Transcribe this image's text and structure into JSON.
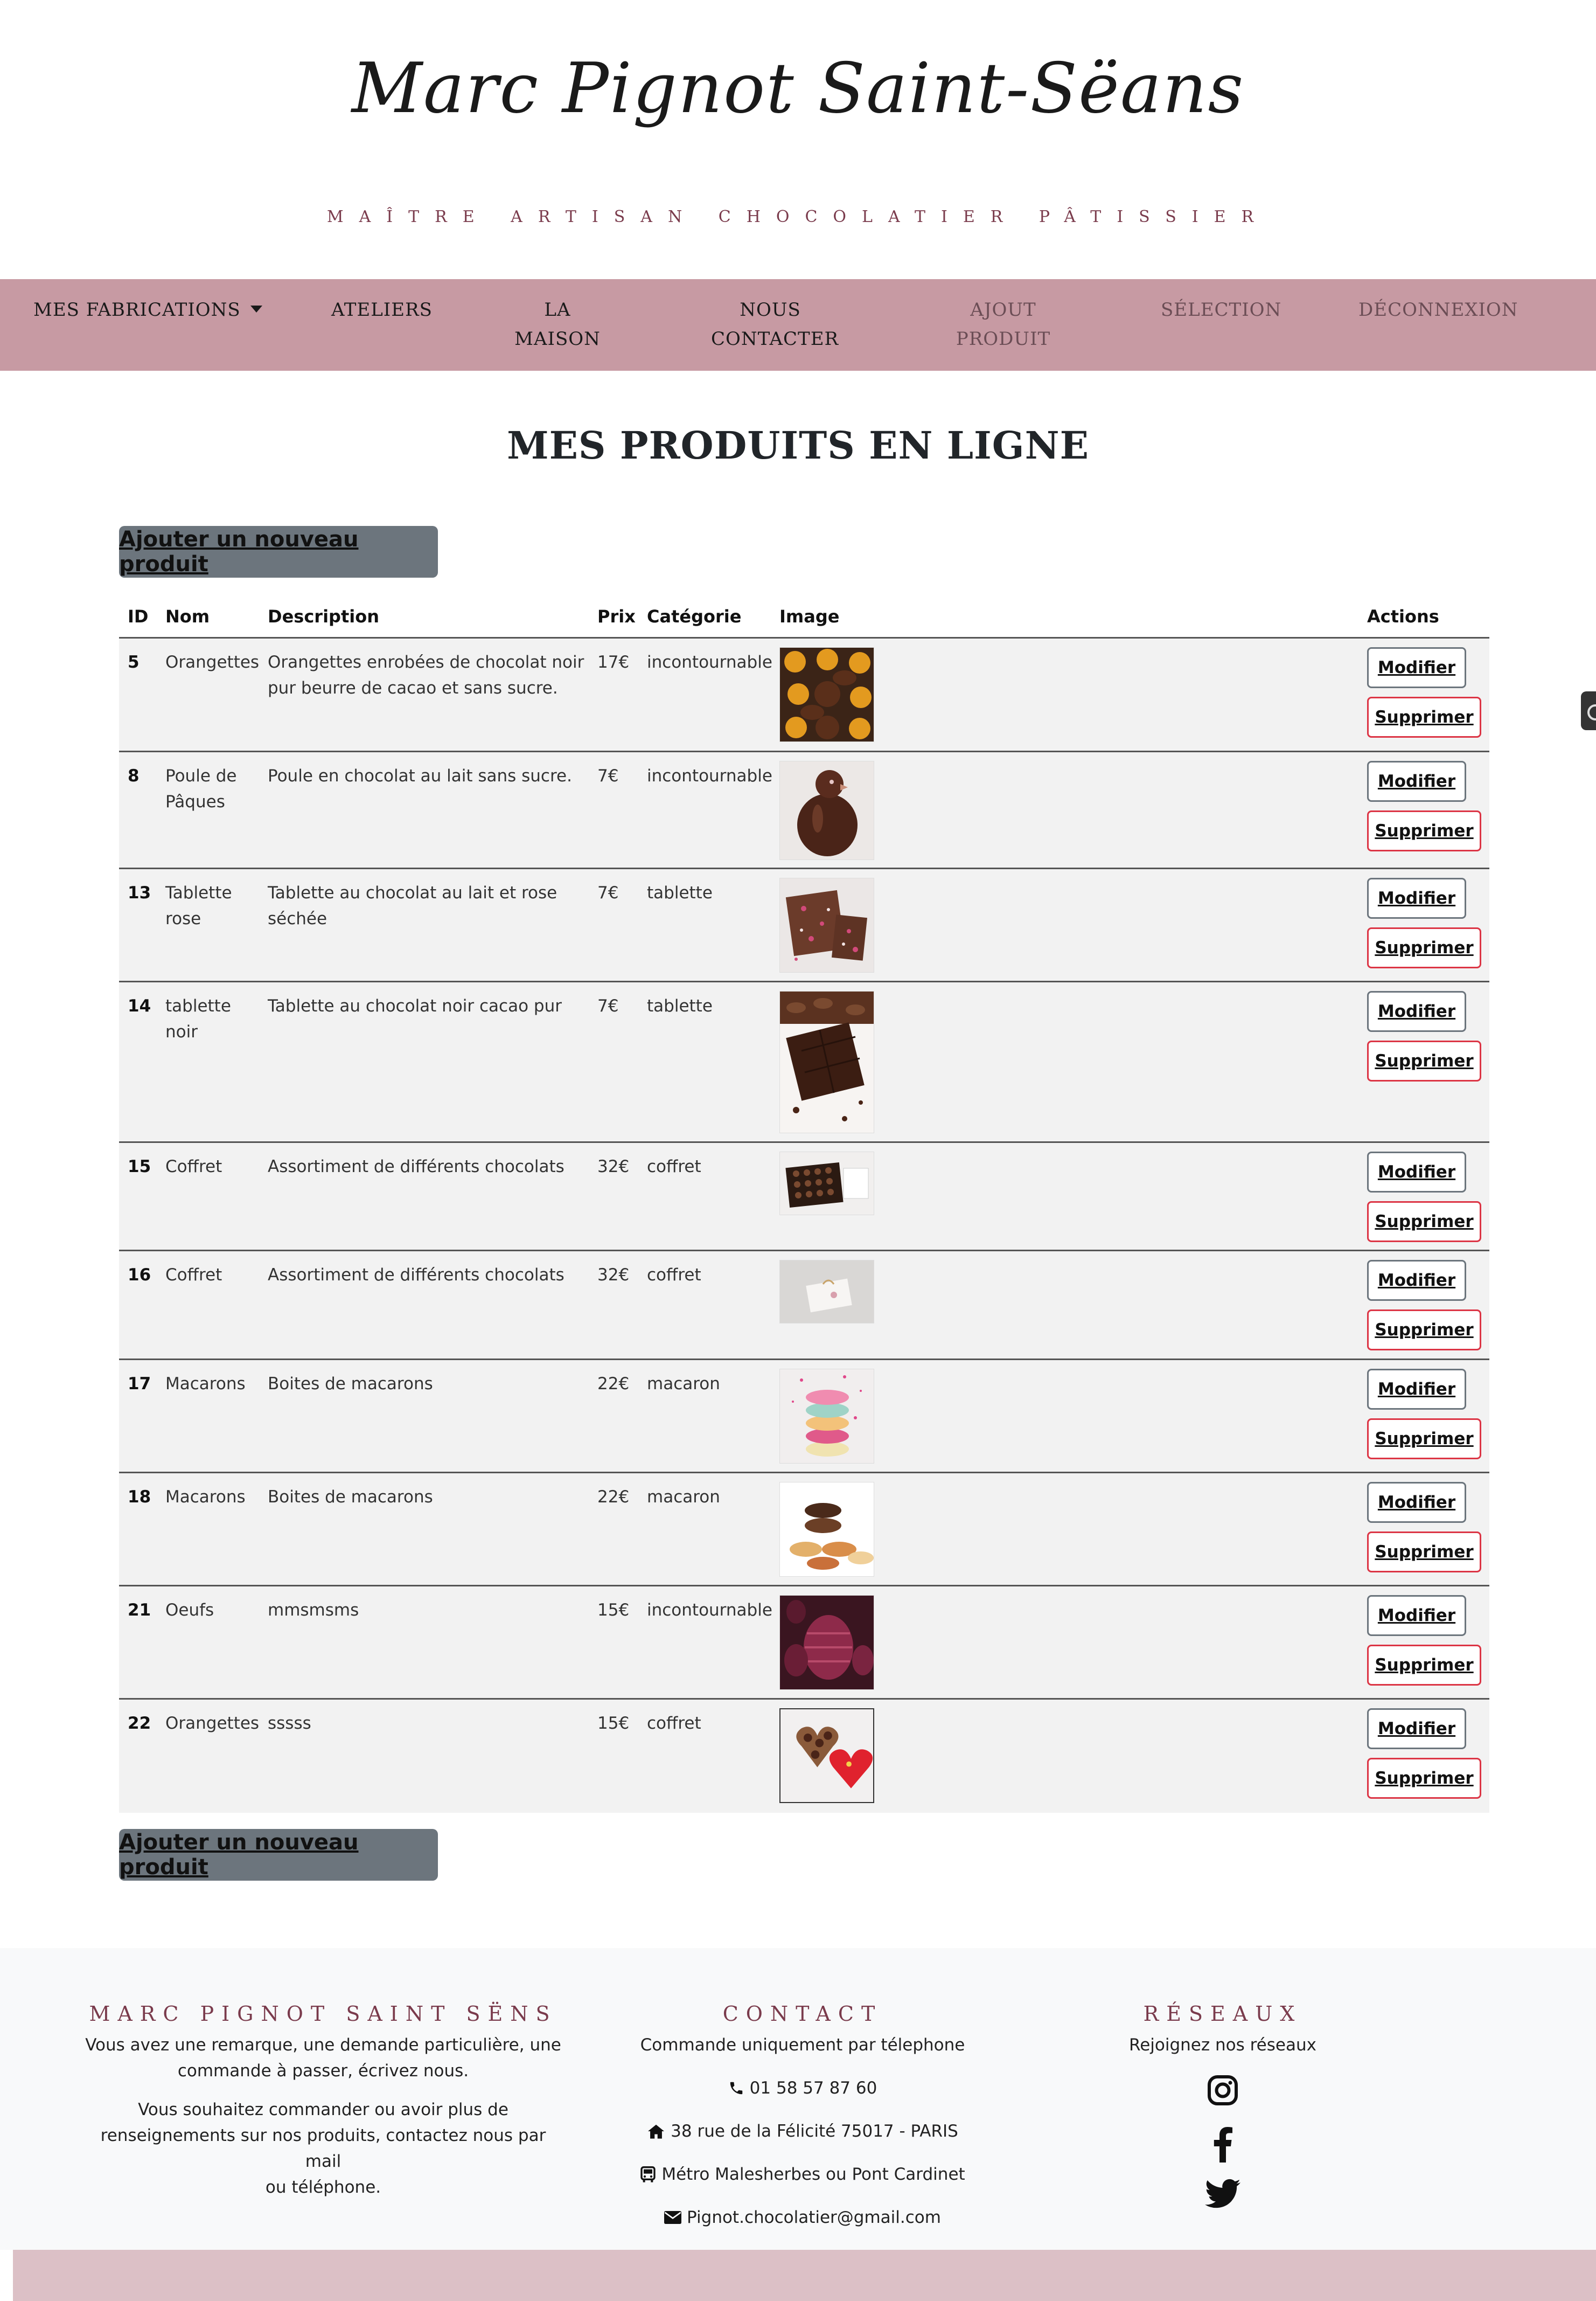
{
  "header": {
    "brand": "Marc Pignot Saint-Sëans",
    "tagline": "MAÎTRE ARTISAN CHOCOLATIER PÂTISSIER"
  },
  "nav": {
    "fabrications": "MES FABRICATIONS",
    "ateliers": "ATELIERS",
    "maison_1": "LA",
    "maison_2": "MAISON",
    "contact_1": "NOUS",
    "contact_2": "CONTACTER",
    "ajout_1": "AJOUT",
    "ajout_2": "PRODUIT",
    "selection": "SÉLECTION",
    "deconnexion": "DÉCONNEXION"
  },
  "main": {
    "title": "MES PRODUITS EN LIGNE",
    "add_button": "Ajouter un nouveau produit"
  },
  "table": {
    "headers": {
      "id": "ID",
      "nom": "Nom",
      "description": "Description",
      "prix": "Prix",
      "categorie": "Catégorie",
      "image": "Image",
      "actions": "Actions"
    },
    "modify_label": "Modifier",
    "delete_label": "Supprimer",
    "rows": [
      {
        "id": "5",
        "nom_1": "Orangettes",
        "nom_2": "",
        "desc_1": "Orangettes enrobées de chocolat noir",
        "desc_2": "pur beurre de cacao et sans sucre.",
        "prix": "17€",
        "categorie": "incontournable",
        "image": "orangettes-photo"
      },
      {
        "id": "8",
        "nom_1": "Poule de",
        "nom_2": "Pâques",
        "desc_1": "Poule en chocolat au lait sans sucre.",
        "desc_2": "",
        "prix": "7€",
        "categorie": "incontournable",
        "image": "chocolate-hen-photo"
      },
      {
        "id": "13",
        "nom_1": "Tablette",
        "nom_2": "rose",
        "desc_1": "Tablette au chocolat au lait et rose",
        "desc_2": "séchée",
        "prix": "7€",
        "categorie": "tablette",
        "image": "rose-bar-photo"
      },
      {
        "id": "14",
        "nom_1": "tablette",
        "nom_2": "noir",
        "desc_1": "Tablette au chocolat noir cacao pur",
        "desc_2": "",
        "prix": "7€",
        "categorie": "tablette",
        "image": "dark-bar-photo"
      },
      {
        "id": "15",
        "nom_1": "Coffret",
        "nom_2": "",
        "desc_1": "Assortiment de différents chocolats",
        "desc_2": "",
        "prix": "32€",
        "categorie": "coffret",
        "image": "chocolate-box-photo"
      },
      {
        "id": "16",
        "nom_1": "Coffret",
        "nom_2": "",
        "desc_1": "Assortiment de différents chocolats",
        "desc_2": "",
        "prix": "32€",
        "categorie": "coffret",
        "image": "gift-box-photo"
      },
      {
        "id": "17",
        "nom_1": "Macarons",
        "nom_2": "",
        "desc_1": "Boites de macarons",
        "desc_2": "",
        "prix": "22€",
        "categorie": "macaron",
        "image": "macaron-stack-photo"
      },
      {
        "id": "18",
        "nom_1": "Macarons",
        "nom_2": "",
        "desc_1": "Boites de macarons",
        "desc_2": "",
        "prix": "22€",
        "categorie": "macaron",
        "image": "macarons-photo"
      },
      {
        "id": "21",
        "nom_1": "Oeufs",
        "nom_2": "",
        "desc_1": "mmsmsms",
        "desc_2": "",
        "prix": "15€",
        "categorie": "incontournable",
        "image": "chocolate-eggs-photo"
      },
      {
        "id": "22",
        "nom_1": "Orangettes",
        "nom_2": "",
        "desc_1": "sssss",
        "desc_2": "",
        "prix": "15€",
        "categorie": "coffret",
        "image": "heart-box-photo"
      }
    ]
  },
  "footer": {
    "col1": {
      "heading": "MARC PIGNOT SAINT SËNS",
      "p1_l1": "Vous avez une remarque, une demande particulière, une",
      "p1_l2": "commande à passer, écrivez nous.",
      "p2_l1": "Vous souhaitez commander ou avoir plus de",
      "p2_l2": "renseignements sur nos produits, contactez nous par mail",
      "p2_l3": "ou téléphone."
    },
    "col2": {
      "heading": "CONTACT",
      "intro": "Commande uniquement par télephone",
      "phone": "01 58 57 87 60",
      "address": "38 rue de la Félicité 75017 - PARIS",
      "metro": "Métro Malesherbes ou Pont Cardinet",
      "email": "Pignot.chocolatier@gmail.com"
    },
    "col3": {
      "heading": "RÉSEAUX",
      "intro": "Rejoignez nos réseaux",
      "icons": [
        "instagram-icon",
        "facebook-icon",
        "twitter-icon"
      ]
    }
  },
  "colors": {
    "nav_bg": "#c79aa3",
    "accent": "#7a3b4c",
    "button_gray": "#6c757d",
    "danger": "#dc3545",
    "bottom_bar": "#dcc0c6"
  }
}
